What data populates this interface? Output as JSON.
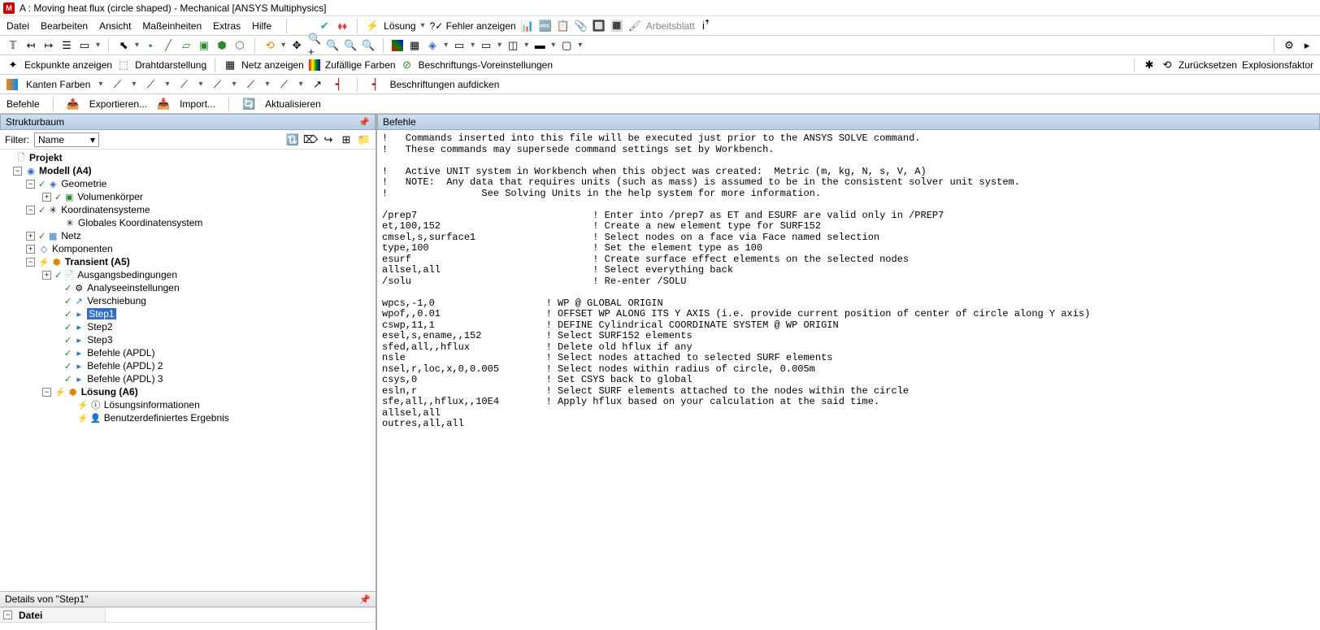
{
  "title": {
    "icon_letter": "M",
    "text": "A : Moving heat flux (circle shaped) - Mechanical [ANSYS Multiphysics]"
  },
  "menubar": {
    "items": [
      "Datei",
      "Bearbeiten",
      "Ansicht",
      "Maßeinheiten",
      "Extras",
      "Hilfe"
    ],
    "losung": "Lösung",
    "fehler": "?✓ Fehler anzeigen",
    "arbeitsblatt": "Arbeitsblatt"
  },
  "toolbar2": {
    "eckpunkte": "Eckpunkte anzeigen",
    "draht": "Drahtdarstellung",
    "netz": "Netz anzeigen",
    "farben": "Zufällige Farben",
    "beschriftung": "Beschriftungs-Voreinstellungen",
    "zuruck": "Zurücksetzen",
    "explosions": "Explosionsfaktor"
  },
  "toolbar3": {
    "kanten": "Kanten Farben",
    "beschriftungen": "Beschriftungen aufdicken"
  },
  "toolbar4": {
    "befehle": "Befehle",
    "exportieren": "Exportieren...",
    "import": "Import...",
    "aktualisieren": "Aktualisieren"
  },
  "panels": {
    "strukturbaum": "Strukturbaum",
    "befehle": "Befehle"
  },
  "filter": {
    "label": "Filter:",
    "value": "Name"
  },
  "tree": {
    "projekt": "Projekt",
    "modell": "Modell (A4)",
    "geometrie": "Geometrie",
    "volumenkorper": "Volumenkörper",
    "koord": "Koordinatensysteme",
    "global_koord": "Globales Koordinatensystem",
    "netz": "Netz",
    "komponenten": "Komponenten",
    "transient": "Transient (A5)",
    "ausgangs": "Ausgangsbedingungen",
    "analyse": "Analyseeinstellungen",
    "verschiebung": "Verschiebung",
    "step1": "Step1",
    "step2": "Step2",
    "step3": "Step3",
    "befehle1": "Befehle (APDL)",
    "befehle2": "Befehle (APDL) 2",
    "befehle3": "Befehle (APDL) 3",
    "losung": "Lösung (A6)",
    "losungsinfo": "Lösungsinformationen",
    "benutzer": "Benutzerdefiniertes Ergebnis"
  },
  "details": {
    "title": "Details von \"Step1\"",
    "datei": "Datei"
  },
  "commands": "!   Commands inserted into this file will be executed just prior to the ANSYS SOLVE command.\n!   These commands may supersede command settings set by Workbench.\n\n!   Active UNIT system in Workbench when this object was created:  Metric (m, kg, N, s, V, A)\n!   NOTE:  Any data that requires units (such as mass) is assumed to be in the consistent solver unit system.\n!                See Solving Units in the help system for more information.\n\n/prep7                              ! Enter into /prep7 as ET and ESURF are valid only in /PREP7\net,100,152                          ! Create a new element type for SURF152\ncmsel,s,surface1                    ! Select nodes on a face via Face named selection\ntype,100                            ! Set the element type as 100\nesurf                               ! Create surface effect elements on the selected nodes\nallsel,all                          ! Select everything back\n/solu                               ! Re-enter /SOLU\n\nwpcs,-1,0                   ! WP @ GLOBAL ORIGIN\nwpof,,0.01                  ! OFFSET WP ALONG ITS Y AXIS (i.e. provide current position of center of circle along Y axis)\ncswp,11,1                   ! DEFINE Cylindrical COORDINATE SYSTEM @ WP ORIGIN\nesel,s,ename,,152           ! Select SURF152 elements\nsfed,all,,hflux             ! Delete old hflux if any\nnsle                        ! Select nodes attached to selected SURF elements\nnsel,r,loc,x,0,0.005        ! Select nodes within radius of circle, 0.005m\ncsys,0                      ! Set CSYS back to global\nesln,r                      ! Select SURF elements attached to the nodes within the circle\nsfe,all,,hflux,,10E4        ! Apply hflux based on your calculation at the said time.\nallsel,all\noutres,all,all"
}
